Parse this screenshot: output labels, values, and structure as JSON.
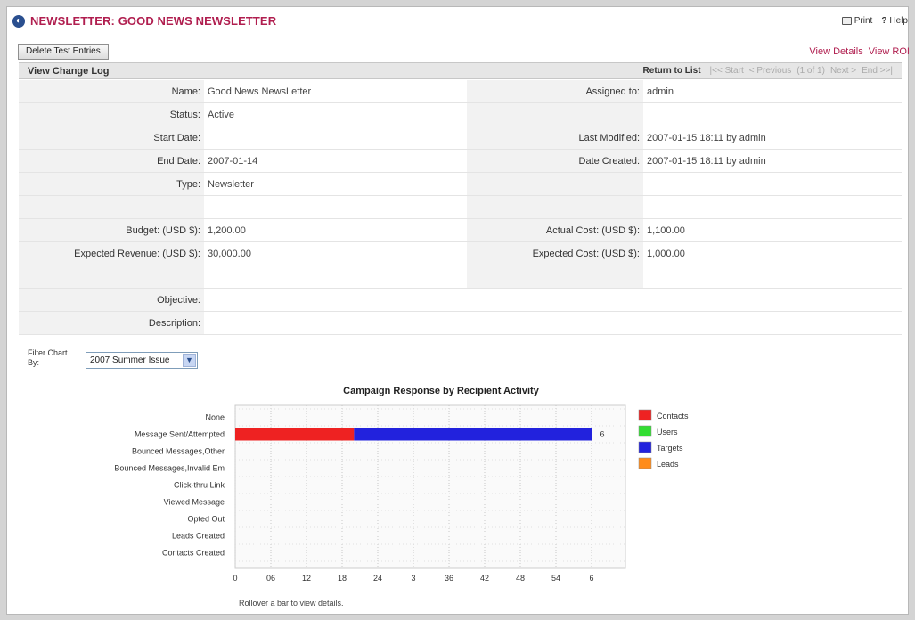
{
  "header": {
    "title": "NEWSLETTER: GOOD NEWS NEWSLETTER",
    "print_label": "Print",
    "help_label": "Help"
  },
  "toolbar": {
    "delete_label": "Delete Test Entries",
    "view_details": "View Details",
    "view_roi": "View ROI"
  },
  "change_log_bar": {
    "label": "View Change Log",
    "return_label": "Return to List",
    "start": "|<< Start",
    "previous": "< Previous",
    "page_info": "(1 of 1)",
    "next": "Next >",
    "end": "End >>|"
  },
  "fields": {
    "name_label": "Name:",
    "name_value": "Good News NewsLetter",
    "assigned_label": "Assigned to:",
    "assigned_value": "admin",
    "status_label": "Status:",
    "status_value": "Active",
    "start_label": "Start Date:",
    "start_value": "",
    "modified_label": "Last Modified:",
    "modified_value": "2007-01-15 18:11 by admin",
    "end_label": "End Date:",
    "end_value": "2007-01-14",
    "created_label": "Date Created:",
    "created_value": "2007-01-15 18:11 by admin",
    "type_label": "Type:",
    "type_value": "Newsletter",
    "budget_label": "Budget: (USD $):",
    "budget_value": "1,200.00",
    "actual_label": "Actual Cost: (USD $):",
    "actual_value": "1,100.00",
    "exp_rev_label": "Expected Revenue: (USD $):",
    "exp_rev_value": "30,000.00",
    "exp_cost_label": "Expected Cost: (USD $):",
    "exp_cost_value": "1,000.00",
    "objective_label": "Objective:",
    "objective_value": "",
    "description_label": "Description:",
    "description_value": ""
  },
  "filter": {
    "label": "Filter Chart By:",
    "selected": "2007 Summer Issue"
  },
  "chart_data": {
    "type": "bar",
    "orientation": "horizontal",
    "stacked": true,
    "title": "Campaign Response by Recipient Activity",
    "categories": [
      "None",
      "Message Sent/Attempted",
      "Bounced Messages,Other",
      "Bounced Messages,Invalid Em",
      "Click-thru Link",
      "Viewed Message",
      "Opted Out",
      "Leads Created",
      "Contacts Created"
    ],
    "series": [
      {
        "name": "Contacts",
        "color": "#ee2222",
        "values": [
          0,
          2,
          0,
          0,
          0,
          0,
          0,
          0,
          0
        ]
      },
      {
        "name": "Users",
        "color": "#33dd33",
        "values": [
          0,
          0,
          0,
          0,
          0,
          0,
          0,
          0,
          0
        ]
      },
      {
        "name": "Targets",
        "color": "#2222dd",
        "values": [
          0,
          4,
          0,
          0,
          0,
          0,
          0,
          0,
          0
        ]
      },
      {
        "name": "Leads",
        "color": "#ff8c1a",
        "values": [
          0,
          0,
          0,
          0,
          0,
          0,
          0,
          0,
          0
        ]
      }
    ],
    "total_labels": [
      "",
      "6",
      "",
      "",
      "",
      "",
      "",
      "",
      ""
    ],
    "xlim": [
      0,
      6
    ],
    "x_tick_labels": [
      "0",
      "06",
      "12",
      "18",
      "24",
      "3",
      "36",
      "42",
      "48",
      "54",
      "6"
    ],
    "grid": true,
    "legend": "right",
    "footnote": "Rollover a bar to view details."
  }
}
